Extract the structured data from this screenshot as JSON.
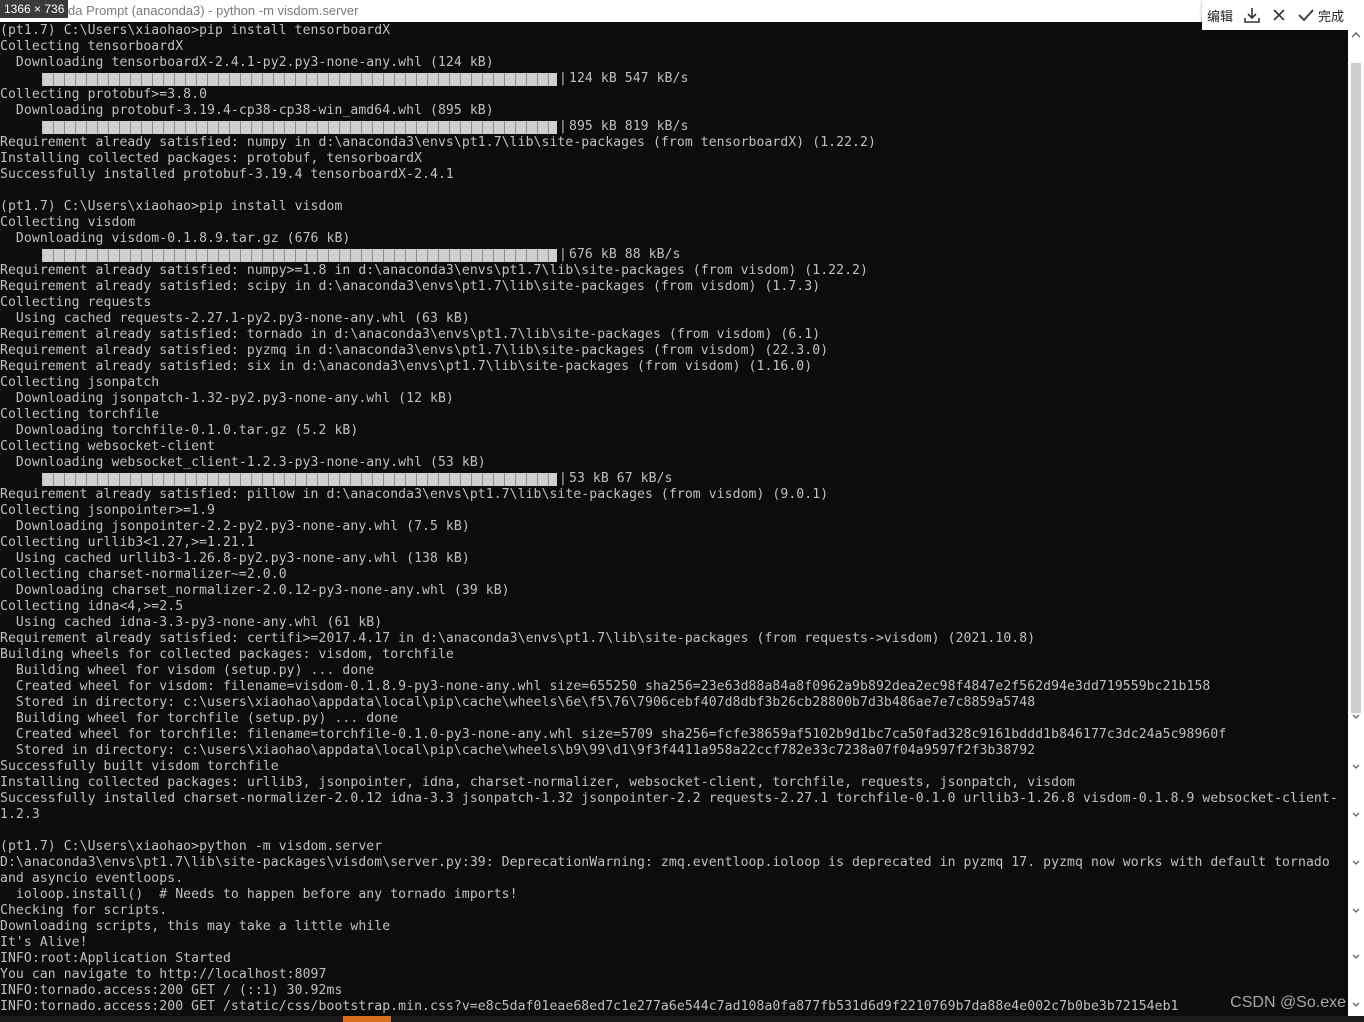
{
  "window": {
    "title": "da Prompt (anaconda3) - python  -m visdom.server",
    "size_badge": "1366 × 736"
  },
  "toolbar": {
    "edit_label": "编辑",
    "done_label": "完成"
  },
  "watermark": "CSDN @So.exe",
  "console": {
    "lines": [
      {
        "text": "(pt1.7) C:\\Users\\xiaohao>pip install tensorboardX"
      },
      {
        "text": "Collecting tensorboardX"
      },
      {
        "text": "  Downloading tensorboardX-2.4.1-py2.py3-none-any.whl (124 kB)"
      },
      {
        "progress": 1.0,
        "text": "124 kB 547 kB/s"
      },
      {
        "text": "Collecting protobuf>=3.8.0"
      },
      {
        "text": "  Downloading protobuf-3.19.4-cp38-cp38-win_amd64.whl (895 kB)"
      },
      {
        "progress": 1.0,
        "text": "895 kB 819 kB/s"
      },
      {
        "text": "Requirement already satisfied: numpy in d:\\anaconda3\\envs\\pt1.7\\lib\\site-packages (from tensorboardX) (1.22.2)"
      },
      {
        "text": "Installing collected packages: protobuf, tensorboardX"
      },
      {
        "text": "Successfully installed protobuf-3.19.4 tensorboardX-2.4.1"
      },
      {
        "text": ""
      },
      {
        "text": "(pt1.7) C:\\Users\\xiaohao>pip install visdom"
      },
      {
        "text": "Collecting visdom"
      },
      {
        "text": "  Downloading visdom-0.1.8.9.tar.gz (676 kB)"
      },
      {
        "progress": 1.0,
        "text": "676 kB 88 kB/s"
      },
      {
        "text": "Requirement already satisfied: numpy>=1.8 in d:\\anaconda3\\envs\\pt1.7\\lib\\site-packages (from visdom) (1.22.2)"
      },
      {
        "text": "Requirement already satisfied: scipy in d:\\anaconda3\\envs\\pt1.7\\lib\\site-packages (from visdom) (1.7.3)"
      },
      {
        "text": "Collecting requests"
      },
      {
        "text": "  Using cached requests-2.27.1-py2.py3-none-any.whl (63 kB)"
      },
      {
        "text": "Requirement already satisfied: tornado in d:\\anaconda3\\envs\\pt1.7\\lib\\site-packages (from visdom) (6.1)"
      },
      {
        "text": "Requirement already satisfied: pyzmq in d:\\anaconda3\\envs\\pt1.7\\lib\\site-packages (from visdom) (22.3.0)"
      },
      {
        "text": "Requirement already satisfied: six in d:\\anaconda3\\envs\\pt1.7\\lib\\site-packages (from visdom) (1.16.0)"
      },
      {
        "text": "Collecting jsonpatch"
      },
      {
        "text": "  Downloading jsonpatch-1.32-py2.py3-none-any.whl (12 kB)"
      },
      {
        "text": "Collecting torchfile"
      },
      {
        "text": "  Downloading torchfile-0.1.0.tar.gz (5.2 kB)"
      },
      {
        "text": "Collecting websocket-client"
      },
      {
        "text": "  Downloading websocket_client-1.2.3-py3-none-any.whl (53 kB)"
      },
      {
        "progress": 1.0,
        "text": "53 kB 67 kB/s"
      },
      {
        "text": "Requirement already satisfied: pillow in d:\\anaconda3\\envs\\pt1.7\\lib\\site-packages (from visdom) (9.0.1)"
      },
      {
        "text": "Collecting jsonpointer>=1.9"
      },
      {
        "text": "  Downloading jsonpointer-2.2-py2.py3-none-any.whl (7.5 kB)"
      },
      {
        "text": "Collecting urllib3<1.27,>=1.21.1"
      },
      {
        "text": "  Using cached urllib3-1.26.8-py2.py3-none-any.whl (138 kB)"
      },
      {
        "text": "Collecting charset-normalizer~=2.0.0"
      },
      {
        "text": "  Downloading charset_normalizer-2.0.12-py3-none-any.whl (39 kB)"
      },
      {
        "text": "Collecting idna<4,>=2.5"
      },
      {
        "text": "  Using cached idna-3.3-py3-none-any.whl (61 kB)"
      },
      {
        "text": "Requirement already satisfied: certifi>=2017.4.17 in d:\\anaconda3\\envs\\pt1.7\\lib\\site-packages (from requests->visdom) (2021.10.8)"
      },
      {
        "text": "Building wheels for collected packages: visdom, torchfile"
      },
      {
        "text": "  Building wheel for visdom (setup.py) ... done"
      },
      {
        "text": "  Created wheel for visdom: filename=visdom-0.1.8.9-py3-none-any.whl size=655250 sha256=23e63d88a84a8f0962a9b892dea2ec98f4847e2f562d94e3dd719559bc21b158"
      },
      {
        "text": "  Stored in directory: c:\\users\\xiaohao\\appdata\\local\\pip\\cache\\wheels\\6e\\f5\\76\\7906cebf407d8dbf3b26cb28800b7d3b486ae7e7c8859a5748"
      },
      {
        "text": "  Building wheel for torchfile (setup.py) ... done"
      },
      {
        "text": "  Created wheel for torchfile: filename=torchfile-0.1.0-py3-none-any.whl size=5709 sha256=fcfe38659af5102b9d1bc7ca50fad328c9161bddd1b846177c3dc24a5c98960f"
      },
      {
        "text": "  Stored in directory: c:\\users\\xiaohao\\appdata\\local\\pip\\cache\\wheels\\b9\\99\\d1\\9f3f4411a958a22ccf782e33c7238a07f04a9597f2f3b38792"
      },
      {
        "text": "Successfully built visdom torchfile"
      },
      {
        "text": "Installing collected packages: urllib3, jsonpointer, idna, charset-normalizer, websocket-client, torchfile, requests, jsonpatch, visdom"
      },
      {
        "text": "Successfully installed charset-normalizer-2.0.12 idna-3.3 jsonpatch-1.32 jsonpointer-2.2 requests-2.27.1 torchfile-0.1.0 urllib3-1.26.8 visdom-0.1.8.9 websocket-client-"
      },
      {
        "text": "1.2.3"
      },
      {
        "text": ""
      },
      {
        "text": "(pt1.7) C:\\Users\\xiaohao>python -m visdom.server"
      },
      {
        "text": "D:\\anaconda3\\envs\\pt1.7\\lib\\site-packages\\visdom\\server.py:39: DeprecationWarning: zmq.eventloop.ioloop is deprecated in pyzmq 17. pyzmq now works with default tornado"
      },
      {
        "text": "and asyncio eventloops."
      },
      {
        "text": "  ioloop.install()  # Needs to happen before any tornado imports!"
      },
      {
        "text": "Checking for scripts."
      },
      {
        "text": "Downloading scripts, this may take a little while"
      },
      {
        "text": "It's Alive!"
      },
      {
        "text": "INFO:root:Application Started"
      },
      {
        "text": "You can navigate to http://localhost:8097"
      },
      {
        "text": "INFO:tornado.access:200 GET / (::1) 30.92ms"
      },
      {
        "text": "INFO:tornado.access:200 GET /static/css/bootstrap.min.css?v=e8c5daf01eae68ed7c1e277a6e544c7ad108a0fa877fb531d6d9f2210769b7da88e4e002c7b0be3b72154eb1"
      }
    ]
  }
}
